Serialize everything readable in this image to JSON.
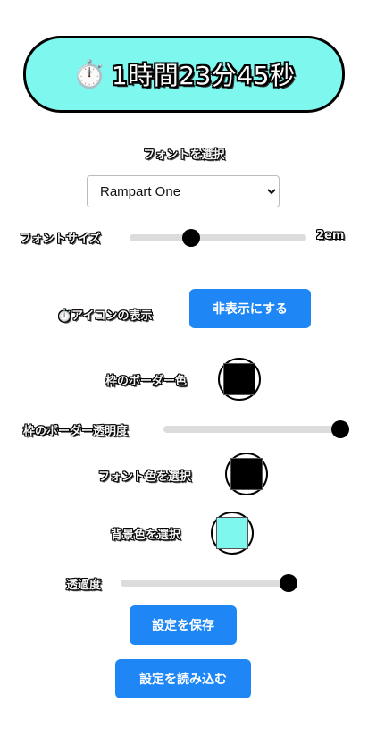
{
  "timer": {
    "icon": "⏱️",
    "text": "1時間23分45秒",
    "bg_color": "#7ef7ef"
  },
  "font_select": {
    "label": "フォントを選択",
    "value": "Rampart One"
  },
  "font_size": {
    "label": "フォントサイズ",
    "value_text": "2em",
    "fraction": 0.35
  },
  "icon_toggle": {
    "label": "⏱️アイコンの表示",
    "button_label": "非表示にする"
  },
  "border_color": {
    "label": "枠のボーダー色",
    "color": "#000000"
  },
  "border_opacity": {
    "label": "枠のボーダー透明度",
    "fraction": 1.0
  },
  "font_color": {
    "label": "フォント色を選択",
    "color": "#000000"
  },
  "bg_color": {
    "label": "背景色を選択",
    "color": "#7ef7ef"
  },
  "opacity": {
    "label": "透過度",
    "fraction": 0.95
  },
  "buttons": {
    "save": "設定を保存",
    "load": "設定を読み込む"
  },
  "colors": {
    "accent": "#1e86f5"
  }
}
